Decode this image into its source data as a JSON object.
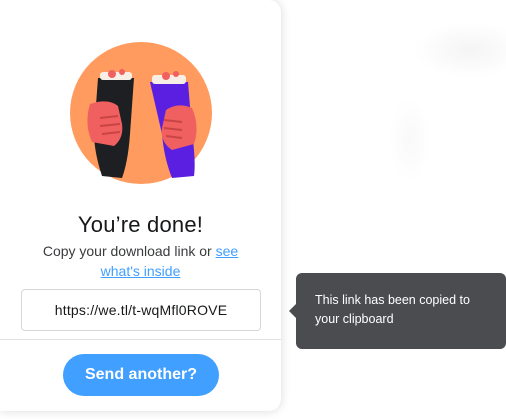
{
  "panel": {
    "illustration_icon": "cheers-glasses-illustration",
    "title": "You’re done!",
    "subtitle_text": "Copy your download link or ",
    "subtitle_link": "see what's inside",
    "download_link": "https://we.tl/t-wqMfl0ROVE",
    "send_another_label": "Send another?"
  },
  "tooltip": {
    "text": "This link has been copied to your clipboard"
  },
  "colors": {
    "accent": "#409fff",
    "tooltip_bg": "#4a4c50",
    "illustration_bg": "#ff9b5e",
    "glass_dark": "#1e1f22",
    "glass_purple": "#5a1fe0",
    "hand": "#f06060"
  }
}
